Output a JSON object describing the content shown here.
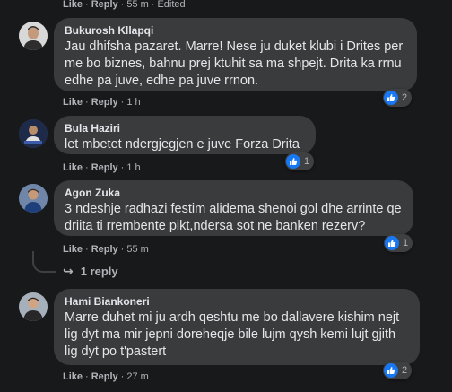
{
  "comments": [
    {
      "author": "Bukurosh Kllapqi",
      "text": "Jau dhifsha pazaret. Marre! Nese ju duket klubi i Drites per me bo biznes, bahnu prej ktuhit sa ma shpejt. Drita ka rrnu edhe pa juve, edhe pa juve rrnon.",
      "reaction_count": "2",
      "like_label": "Like",
      "reply_label": "Reply",
      "time": "1 h"
    },
    {
      "author": "Bula Haziri",
      "text": "let mbetet ndergjegjen e juve Forza Drita",
      "reaction_count": "1",
      "like_label": "Like",
      "reply_label": "Reply",
      "time": "1 h"
    },
    {
      "author": "Agon Zuka",
      "text": "3 ndeshje radhazi festim alidema shenoi gol dhe arrinte qe driita ti rrembente pikt,ndersa sot ne banken rezerv?",
      "reaction_count": "1",
      "like_label": "Like",
      "reply_label": "Reply",
      "time": "55 m",
      "replies_label": "1 reply"
    },
    {
      "author": "Hami Biankoneri",
      "text": "Marre duhet mi ju ardh qeshtu me bo dallavere kishim nejt lig dyt ma mir jepni doreheqje bile lujm qysh kemi lujt gjith lig dyt po t'pastert",
      "reaction_count": "2",
      "like_label": "Like",
      "reply_label": "Reply",
      "time": "27 m"
    }
  ],
  "top_action": {
    "like_label": "Like",
    "reply_label": "Reply",
    "time": "55 m",
    "edited": "Edited"
  },
  "colors": {
    "background": "#18191a",
    "bubble": "#3a3b3c",
    "like_blue": "#1877f2"
  }
}
